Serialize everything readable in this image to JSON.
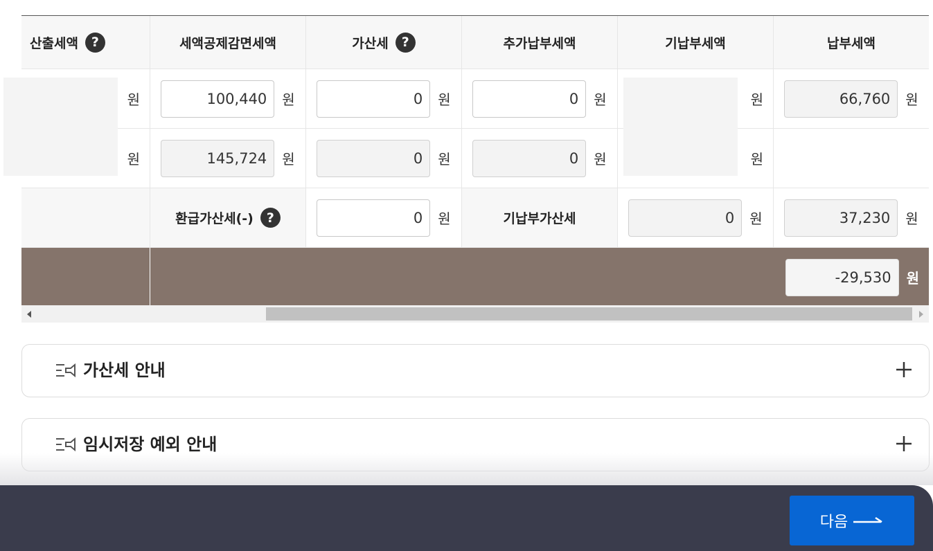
{
  "table": {
    "headers": [
      "산출세액",
      "세액공제감면세액",
      "가산세",
      "추가납부세액",
      "기납부세액",
      "납부세액"
    ],
    "help_mark": "?",
    "unit": "원",
    "row1": {
      "credit": "100,440",
      "penalty": "0",
      "additional": "0",
      "payable": "66,760"
    },
    "row2": {
      "credit": "145,724",
      "penalty": "0",
      "additional": "0"
    },
    "row3": {
      "refund_penalty_label": "환급가산세(-)",
      "refund_penalty": "0",
      "prepaid_penalty_label": "기납부가산세",
      "prepaid_penalty": "0",
      "payable": "37,230"
    },
    "total": {
      "value": "-29,530"
    }
  },
  "accordions": [
    {
      "label": "가산세 안내"
    },
    {
      "label": "임시저장 예외 안내"
    }
  ],
  "footer": {
    "next_label": "다음"
  },
  "colors": {
    "total_row": "#85746b",
    "footer": "#3a3c4c",
    "primary_button": "#0866d4"
  }
}
